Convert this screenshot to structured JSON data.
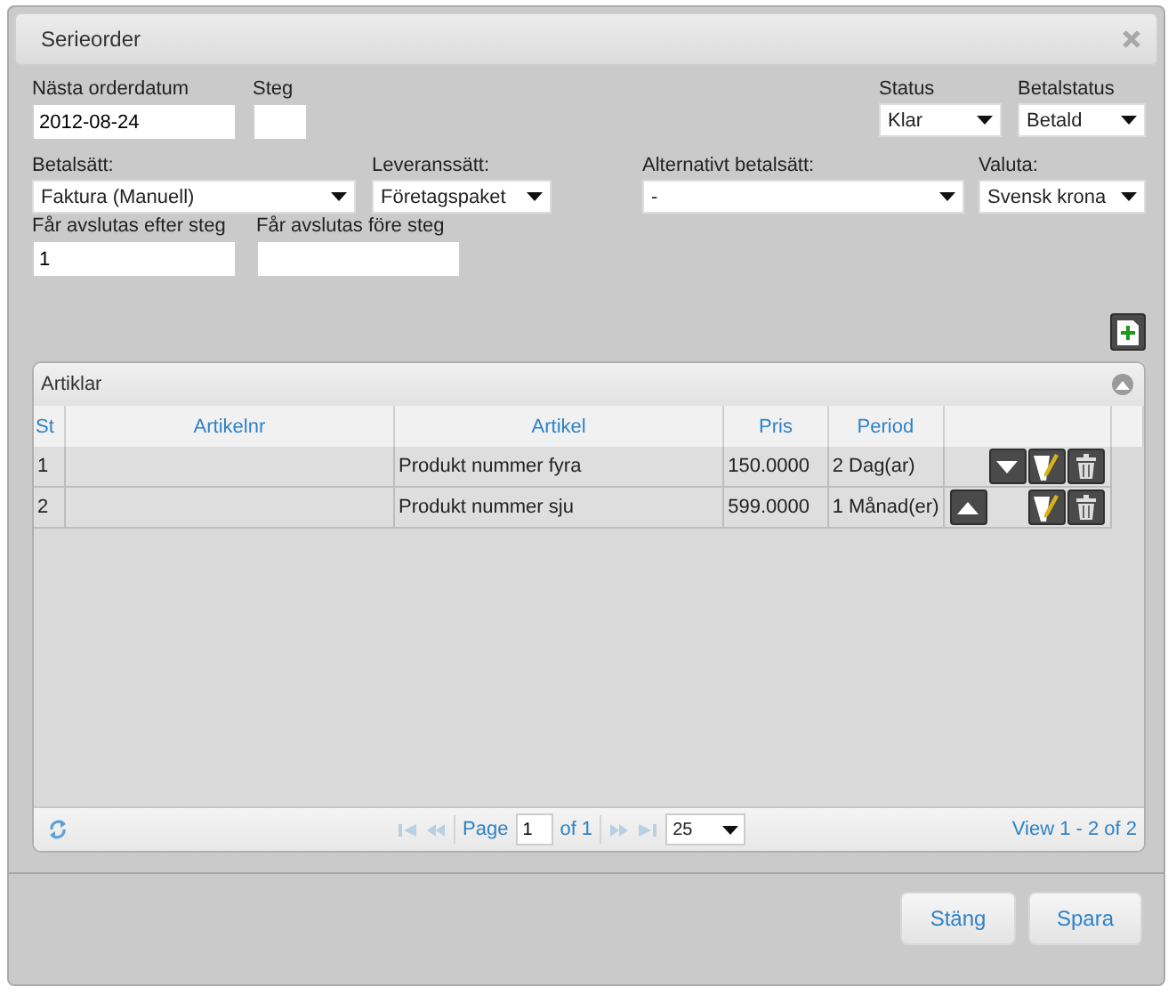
{
  "window": {
    "title": "Serieorder"
  },
  "form_rows": [
    {
      "left": [
        {
          "label": "Nästa orderdatum",
          "kind": "text",
          "value": "2012-08-24"
        },
        {
          "label": "Steg",
          "kind": "text"
        }
      ],
      "right": [
        {
          "label": "Status",
          "kind": "select",
          "value": "Klar"
        },
        {
          "label": "Betalstatus",
          "kind": "select",
          "value": "Betald"
        }
      ]
    },
    {
      "left": [
        {
          "label": "Betalsätt:",
          "kind": "select",
          "value": "Faktura (Manuell)"
        },
        {
          "label": "Leveranssätt:",
          "kind": "select",
          "value": "Företagspaket"
        },
        {
          "label": "Alternativt betalsätt:",
          "kind": "select",
          "value": "-"
        }
      ],
      "right": [
        {
          "label": "Valuta:",
          "kind": "select",
          "value": "Svensk krona"
        }
      ]
    },
    {
      "left": [
        {
          "label": "Får avslutas efter steg",
          "kind": "text",
          "value": "1"
        },
        {
          "label": "Får avslutas före steg",
          "kind": "text"
        }
      ],
      "right": []
    }
  ],
  "grid": {
    "title": "Artiklar",
    "columns": [
      "St",
      "Artikelnr",
      "Artikel",
      "Pris",
      "Period"
    ],
    "rows": [
      {
        "cells": [
          "1",
          "",
          "Produkt nummer fyra",
          "150.0000",
          "2 Dag(ar)"
        ],
        "actions": [
          {
            "kind": "down"
          },
          {
            "kind": "edit"
          },
          {
            "kind": "delete"
          }
        ]
      },
      {
        "cells": [
          "2",
          "",
          "Produkt nummer sju",
          "599.0000",
          "1 Månad(er)"
        ],
        "actions": [
          {
            "kind": "up"
          },
          {
            "kind": "edit"
          },
          {
            "kind": "delete"
          }
        ]
      }
    ],
    "pager": {
      "page_label": "Page",
      "page": "1",
      "of": "of 1",
      "page_size": "25",
      "view": "View 1 - 2 of 2"
    }
  },
  "buttons": [
    "Stäng",
    "Spara"
  ]
}
